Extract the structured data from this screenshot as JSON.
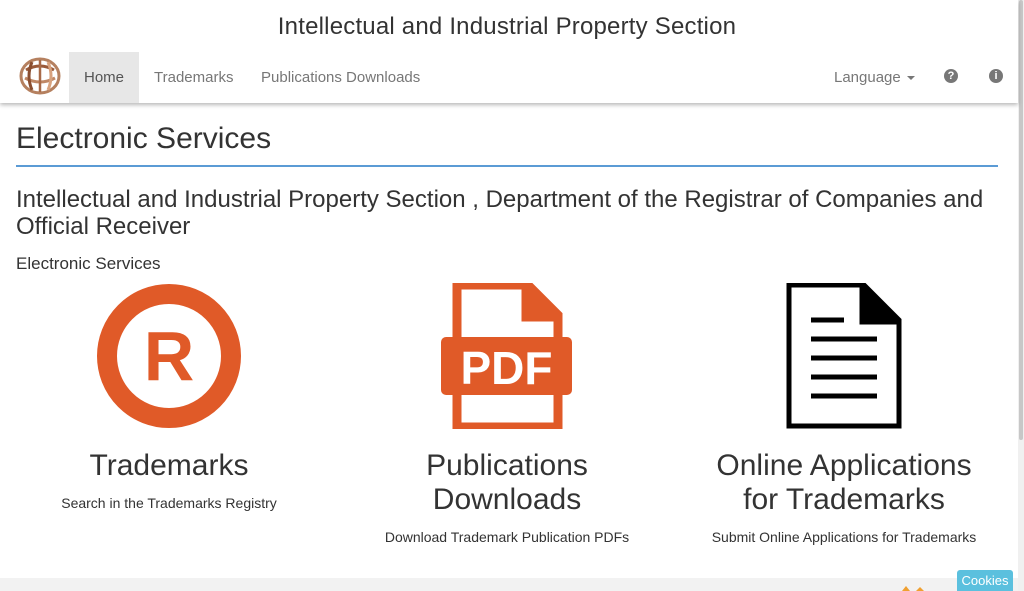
{
  "header": {
    "site_title": "Intellectual and Industrial Property Section",
    "logo": "site-logo",
    "nav": {
      "home": "Home",
      "trademarks": "Trademarks",
      "publications": "Publications Downloads",
      "language": "Language"
    },
    "icons": [
      "question-circle-icon",
      "info-circle-icon"
    ]
  },
  "main": {
    "heading": "Electronic Services",
    "subtitle": "Intellectual and Industrial Property Section , Department of the Registrar of Companies and Official Receiver",
    "section_label": "Electronic Services",
    "services": [
      {
        "icon": "registered-trademark-icon",
        "title": "Trademarks",
        "description": "Search in the Trademarks Registry"
      },
      {
        "icon": "pdf-file-icon",
        "title": "Publications Downloads",
        "description": "Download Trademark Publication PDFs"
      },
      {
        "icon": "document-icon",
        "title": "Online Applications for Trademarks",
        "description": "Submit Online Applications for Trademarks"
      }
    ]
  },
  "footer": {
    "cookies_label": "Cookies"
  },
  "colors": {
    "accent_orange": "#e05a28",
    "heading_rule": "#5b9bd5",
    "cookies_button": "#5bc0de",
    "active_nav_bg": "#e7e7e7"
  }
}
